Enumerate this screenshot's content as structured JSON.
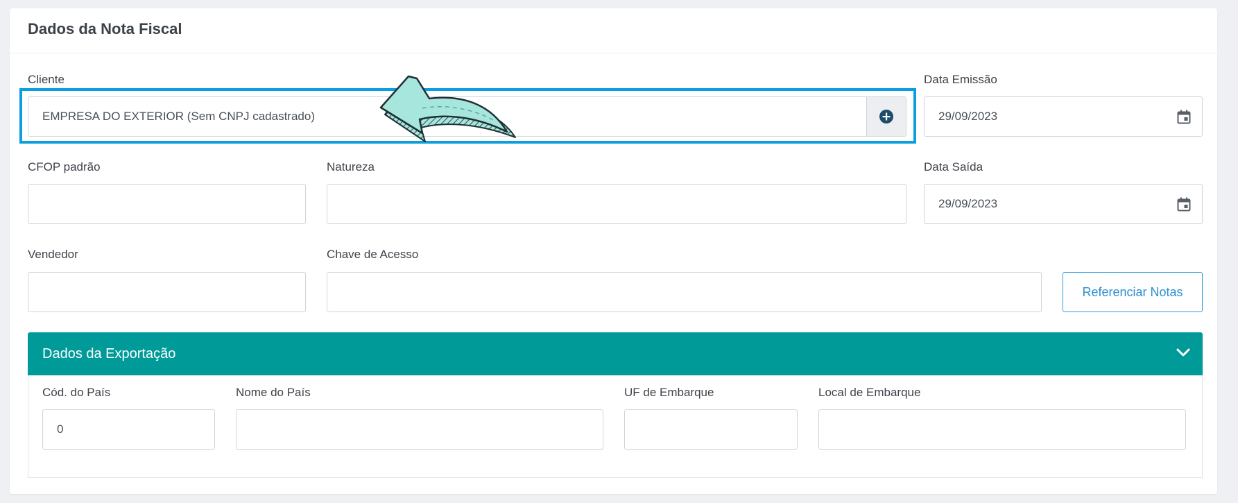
{
  "card": {
    "title": "Dados da Nota Fiscal"
  },
  "cliente": {
    "label": "Cliente",
    "value": "EMPRESA DO EXTERIOR (Sem CNPJ cadastrado)",
    "add_icon": "plus-circle-icon"
  },
  "data_emissao": {
    "label": "Data Emissão",
    "value": "29/09/2023",
    "icon": "calendar-icon"
  },
  "cfop": {
    "label": "CFOP padrão",
    "value": ""
  },
  "natureza": {
    "label": "Natureza",
    "value": ""
  },
  "data_saida": {
    "label": "Data Saída",
    "value": "29/09/2023",
    "icon": "calendar-icon"
  },
  "vendedor": {
    "label": "Vendedor",
    "value": ""
  },
  "chave": {
    "label": "Chave de Acesso",
    "value": ""
  },
  "referenciar_button": "Referenciar Notas",
  "exportacao": {
    "title": "Dados da Exportação",
    "toggle_icon": "chevron-down-icon",
    "cod_pais": {
      "label": "Cód. do País",
      "value": "0"
    },
    "nome_pais": {
      "label": "Nome do País",
      "value": ""
    },
    "uf_embarque": {
      "label": "UF de Embarque",
      "value": ""
    },
    "local_embarque": {
      "label": "Local de Embarque",
      "value": ""
    }
  },
  "annotation": {
    "arrow_icon": "pointer-arrow-icon"
  },
  "colors": {
    "accent": "#009a98",
    "highlight": "#0b9fe0",
    "button": "#2b9ad9",
    "arrow_fill": "#a6e6dc",
    "plus_icon": "#1d4d6b"
  }
}
